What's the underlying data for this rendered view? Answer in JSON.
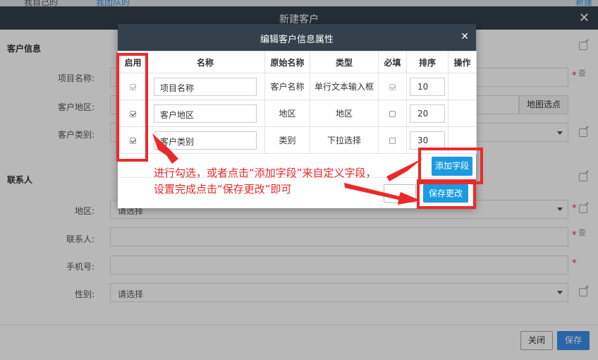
{
  "page_strip": {
    "left_text": "我自己的",
    "mid_text": "我团队的",
    "right_text": "新建"
  },
  "outer_modal": {
    "title": "新建客户",
    "close_glyph": "✕",
    "sections": {
      "customer_info": "客户信息",
      "contact": "联系人"
    },
    "fields": {
      "project_name_label": "项目名称:",
      "customer_region_label": "客户地区:",
      "map_pick_label": "地图选点",
      "customer_type_label": "客户类别:",
      "region_label": "地区:",
      "region_value": "请选择",
      "contact_label": "联系人:",
      "phone_label": "手机号:",
      "gender_label": "性别:",
      "gender_value": "请选择",
      "required_mark": "*",
      "side_mark": "查"
    },
    "footer": {
      "close_label": "关闭",
      "save_label": "保存"
    }
  },
  "inner_modal": {
    "title": "编辑客户信息属性",
    "close_glyph": "✕",
    "columns": [
      "启用",
      "名称",
      "原始名称",
      "类型",
      "必填",
      "排序",
      "操作"
    ],
    "rows": [
      {
        "enabled": true,
        "enabled_locked": true,
        "name": "项目名称",
        "original": "客户名称",
        "type": "单行文本输入框",
        "required": true,
        "required_locked": true,
        "sort": "10"
      },
      {
        "enabled": true,
        "enabled_locked": false,
        "name": "客户地区",
        "original": "地区",
        "type": "地区",
        "required": false,
        "required_locked": false,
        "sort": "20"
      },
      {
        "enabled": true,
        "enabled_locked": false,
        "name": "客户类别",
        "original": "类别",
        "type": "下拉选择",
        "required": false,
        "required_locked": false,
        "sort": "30"
      }
    ],
    "add_field_label": "添加字段",
    "save_changes_label": "保存更改"
  },
  "annotation": {
    "line1": "进行勾选，或者点击“添加字段”来自定义字段，",
    "line2": "设置完成点击“保存更改”即可",
    "color": "#e82828"
  },
  "colors": {
    "header_bg": "#34414c",
    "primary": "#1a9be0",
    "outer_primary": "#3a8ee6",
    "annotation_red": "#ea2a2a"
  }
}
